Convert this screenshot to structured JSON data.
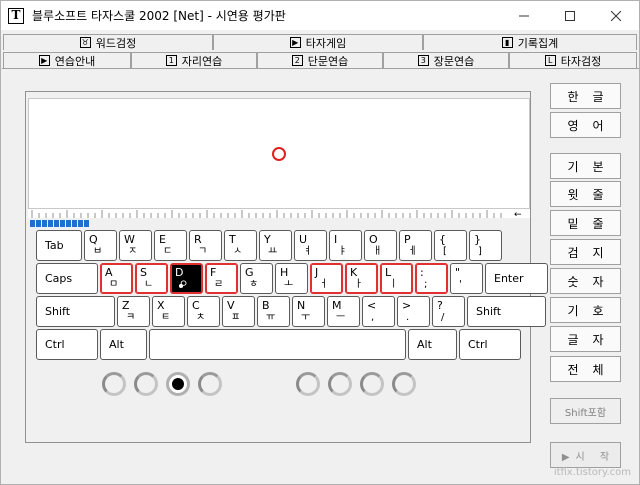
{
  "window": {
    "title": "블루소프트 타자스쿨 2002 [Net] - 시연용 평가판",
    "app_icon": "T",
    "controls": [
      "minimize-icon",
      "maximize-icon",
      "close-icon"
    ]
  },
  "tabs_top": [
    {
      "label": "워드검정",
      "icon": "♉"
    },
    {
      "label": "타자게임",
      "icon": "▶"
    },
    {
      "label": "기록집계",
      "icon": "▮"
    }
  ],
  "tabs_bottom": [
    {
      "label": "연습안내",
      "icon": "▶"
    },
    {
      "label": "자리연습",
      "icon": "1",
      "active": true
    },
    {
      "label": "단문연습",
      "icon": "2"
    },
    {
      "label": "장문연습",
      "icon": "3"
    },
    {
      "label": "타자검정",
      "icon": "L"
    }
  ],
  "progress": {
    "segments": 10
  },
  "keyboard": {
    "row1": [
      {
        "en": "Tab",
        "mod": true
      },
      {
        "en": "Q",
        "ko": "ㅂ"
      },
      {
        "en": "W",
        "ko": "ㅈ"
      },
      {
        "en": "E",
        "ko": "ㄷ"
      },
      {
        "en": "R",
        "ko": "ㄱ"
      },
      {
        "en": "T",
        "ko": "ㅅ"
      },
      {
        "en": "Y",
        "ko": "ㅛ"
      },
      {
        "en": "U",
        "ko": "ㅕ"
      },
      {
        "en": "I",
        "ko": "ㅑ"
      },
      {
        "en": "O",
        "ko": "ㅐ"
      },
      {
        "en": "P",
        "ko": "ㅔ"
      },
      {
        "en": "{",
        "ko": "["
      },
      {
        "en": "}",
        "ko": "]"
      }
    ],
    "row2": [
      {
        "en": "Caps",
        "mod": true
      },
      {
        "en": "A",
        "ko": "ㅁ"
      },
      {
        "en": "S",
        "ko": "ㄴ"
      },
      {
        "en": "D",
        "ko": "ㅇ"
      },
      {
        "en": "F",
        "ko": "ㄹ"
      },
      {
        "en": "G",
        "ko": "ㅎ"
      },
      {
        "en": "H",
        "ko": "ㅗ"
      },
      {
        "en": "J",
        "ko": "ㅓ"
      },
      {
        "en": "K",
        "ko": "ㅏ"
      },
      {
        "en": "L",
        "ko": "ㅣ"
      },
      {
        "en": ":",
        "ko": ";"
      },
      {
        "en": "\"",
        "ko": "'"
      },
      {
        "en": "Enter",
        "mod": true
      }
    ],
    "row3": [
      {
        "en": "Shift",
        "mod": true
      },
      {
        "en": "Z",
        "ko": "ㅋ"
      },
      {
        "en": "X",
        "ko": "ㅌ"
      },
      {
        "en": "C",
        "ko": "ㅊ"
      },
      {
        "en": "V",
        "ko": "ㅍ"
      },
      {
        "en": "B",
        "ko": "ㅠ"
      },
      {
        "en": "N",
        "ko": "ㅜ"
      },
      {
        "en": "M",
        "ko": "ㅡ"
      },
      {
        "en": "<",
        "ko": ","
      },
      {
        "en": ">",
        "ko": "."
      },
      {
        "en": "?",
        "ko": "/"
      },
      {
        "en": "Shift",
        "mod": true
      }
    ],
    "row4": [
      {
        "en": "Ctrl",
        "mod": true
      },
      {
        "en": "Alt",
        "mod": true
      },
      {
        "en": "",
        "mod": true
      },
      {
        "en": "Alt",
        "mod": true
      },
      {
        "en": "Ctrl",
        "mod": true
      }
    ],
    "active_key": "D"
  },
  "fingers": {
    "count": 8,
    "active_index": 2
  },
  "side_buttons": [
    {
      "label": "한글"
    },
    {
      "label": "영어"
    },
    {
      "label": "기본"
    },
    {
      "label": "윗줄"
    },
    {
      "label": "밑줄"
    },
    {
      "label": "검지"
    },
    {
      "label": "숫자"
    },
    {
      "label": "기호"
    },
    {
      "label": "글자"
    },
    {
      "label": "전체"
    },
    {
      "label": "Shift포함"
    },
    {
      "label": "▶시 작"
    }
  ],
  "watermark": "itfix.tistory.com"
}
